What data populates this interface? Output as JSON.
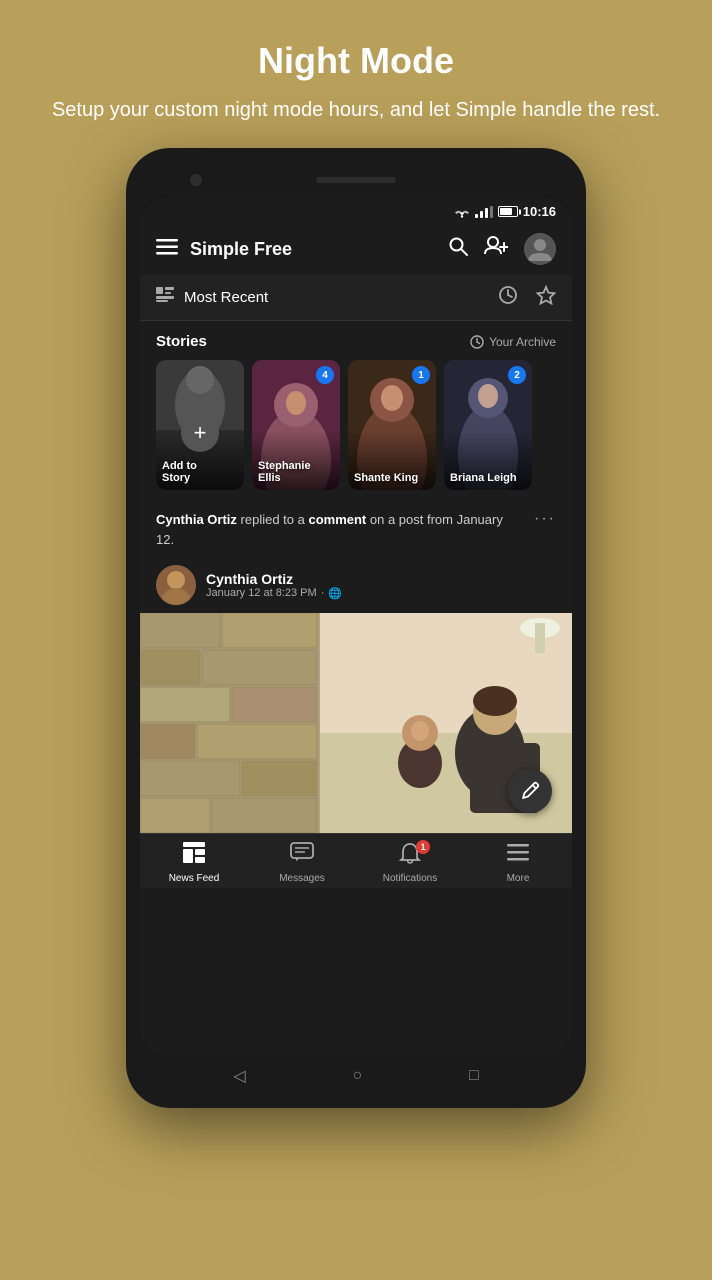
{
  "page": {
    "title": "Night Mode",
    "subtitle": "Setup your custom night mode hours, and let Simple handle the rest.",
    "background_color": "#b8a05a"
  },
  "status_bar": {
    "time": "10:16"
  },
  "app_bar": {
    "title": "Simple Free"
  },
  "filter_bar": {
    "label": "Most Recent"
  },
  "stories": {
    "section_title": "Stories",
    "archive_label": "Your Archive",
    "items": [
      {
        "id": 0,
        "name": "Add to\nStory",
        "is_add": true,
        "badge": null
      },
      {
        "id": 1,
        "name": "Stephanie Ellis",
        "is_add": false,
        "badge": "4"
      },
      {
        "id": 2,
        "name": "Shante King",
        "is_add": false,
        "badge": "1"
      },
      {
        "id": 3,
        "name": "Briana Leigh",
        "is_add": false,
        "badge": "2"
      }
    ]
  },
  "post": {
    "notification_text_start": "Cynthia Ortiz",
    "notification_text_mid": " replied to a ",
    "notification_text_bold": "comment",
    "notification_text_end": " on a post from January 12.",
    "author_name": "Cynthia Ortiz",
    "author_meta": "January 12 at 8:23 PM · 🌐",
    "more_icon": "•••"
  },
  "bottom_nav": {
    "items": [
      {
        "id": "news-feed",
        "label": "News Feed",
        "active": true
      },
      {
        "id": "messages",
        "label": "Messages",
        "active": false
      },
      {
        "id": "notifications",
        "label": "Notifications",
        "active": false,
        "badge": "1"
      },
      {
        "id": "more",
        "label": "More",
        "active": false
      }
    ]
  },
  "gestures": {
    "back": "◁",
    "home": "○",
    "recent": "□"
  }
}
